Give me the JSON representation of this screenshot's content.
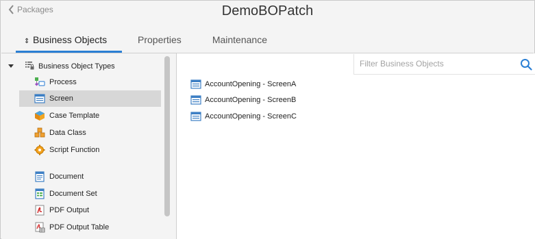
{
  "header": {
    "back_label": "Packages",
    "title": "DemoBOPatch"
  },
  "tabs": [
    {
      "label": "Business Objects",
      "active": true,
      "icon": "sort-arrows-icon"
    },
    {
      "label": "Properties",
      "active": false
    },
    {
      "label": "Maintenance",
      "active": false
    }
  ],
  "tree": {
    "root_label": "Business Object Types",
    "items": [
      {
        "label": "Process",
        "icon": "process-icon",
        "selected": false
      },
      {
        "label": "Screen",
        "icon": "screen-icon",
        "selected": true
      },
      {
        "label": "Case Template",
        "icon": "case-template-icon",
        "selected": false
      },
      {
        "label": "Data Class",
        "icon": "data-class-icon",
        "selected": false
      },
      {
        "label": "Script Function",
        "icon": "script-function-icon",
        "selected": false
      },
      {
        "label": "Document",
        "icon": "document-icon",
        "selected": false
      },
      {
        "label": "Document Set",
        "icon": "document-set-icon",
        "selected": false
      },
      {
        "label": "PDF Output",
        "icon": "pdf-output-icon",
        "selected": false
      },
      {
        "label": "PDF Output Table",
        "icon": "pdf-output-table-icon",
        "selected": false
      }
    ]
  },
  "filter": {
    "placeholder": "Filter Business Objects",
    "value": ""
  },
  "objects": [
    {
      "label": "AccountOpening - ScreenA"
    },
    {
      "label": "AccountOpening - ScreenB"
    },
    {
      "label": "AccountOpening - ScreenC"
    }
  ],
  "colors": {
    "accent": "#2a7fd4",
    "selected_row": "#d7d7d7",
    "panel_bg": "#f4f4f4"
  }
}
